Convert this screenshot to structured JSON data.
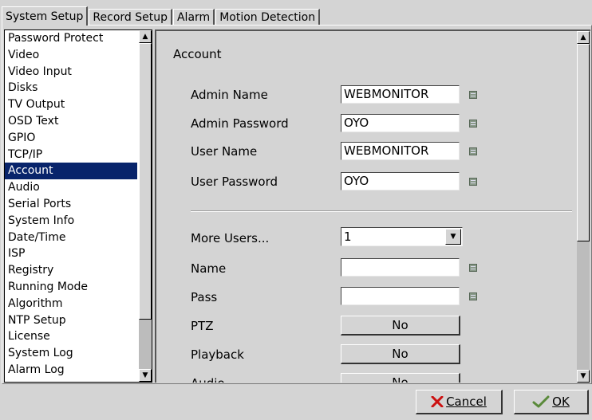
{
  "tabs": [
    {
      "label": "System Setup",
      "active": true
    },
    {
      "label": "Record Setup",
      "active": false
    },
    {
      "label": "Alarm",
      "active": false
    },
    {
      "label": "Motion Detection",
      "active": false
    }
  ],
  "sidebar": {
    "items": [
      "Password Protect",
      "Video",
      "Video Input",
      "Disks",
      "TV Output",
      "OSD Text",
      "GPIO",
      "TCP/IP",
      "Account",
      "Audio",
      "Serial Ports",
      "System Info",
      "Date/Time",
      "ISP",
      "Registry",
      "Running Mode",
      "Algorithm",
      "NTP Setup",
      "License",
      "System Log",
      "Alarm Log"
    ],
    "selected": "Account"
  },
  "account": {
    "section_title": "Account",
    "admin_name_label": "Admin Name",
    "admin_name_value": "WEBMONITOR",
    "admin_password_label": "Admin Password",
    "admin_password_value": "OYO",
    "user_name_label": "User Name",
    "user_name_value": "WEBMONITOR",
    "user_password_label": "User Password",
    "user_password_value": "OYO",
    "more_users_label": "More Users...",
    "more_users_value": "1",
    "name_label": "Name",
    "name_value": "",
    "pass_label": "Pass",
    "pass_value": "",
    "ptz_label": "PTZ",
    "ptz_value": "No",
    "playback_label": "Playback",
    "playback_value": "No",
    "audio_label": "Audio",
    "audio_value": "No"
  },
  "footer": {
    "cancel_label": "Cancel",
    "ok_label": "OK"
  },
  "colors": {
    "selection_bg": "#08246b",
    "window_bg": "#d4d4d4",
    "cancel_icon": "#cc1111",
    "ok_icon": "#5a8a3a"
  },
  "icons": {
    "keyboard": "keyboard-icon",
    "cancel": "x-icon",
    "ok": "checkmark-icon",
    "dropdown": "chevron-down-icon"
  }
}
